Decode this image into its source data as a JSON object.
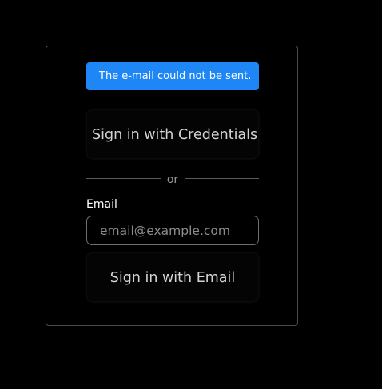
{
  "alert": {
    "message": "The e-mail could not be sent."
  },
  "credentials_button": {
    "label": "Sign in with Credentials"
  },
  "divider": {
    "text": "or"
  },
  "email_form": {
    "label": "Email",
    "placeholder": "email@example.com",
    "value": "",
    "submit_label": "Sign in with Email"
  },
  "colors": {
    "background": "#000000",
    "alert_background": "#1e86f5",
    "card_border": "#4a4a4a"
  }
}
